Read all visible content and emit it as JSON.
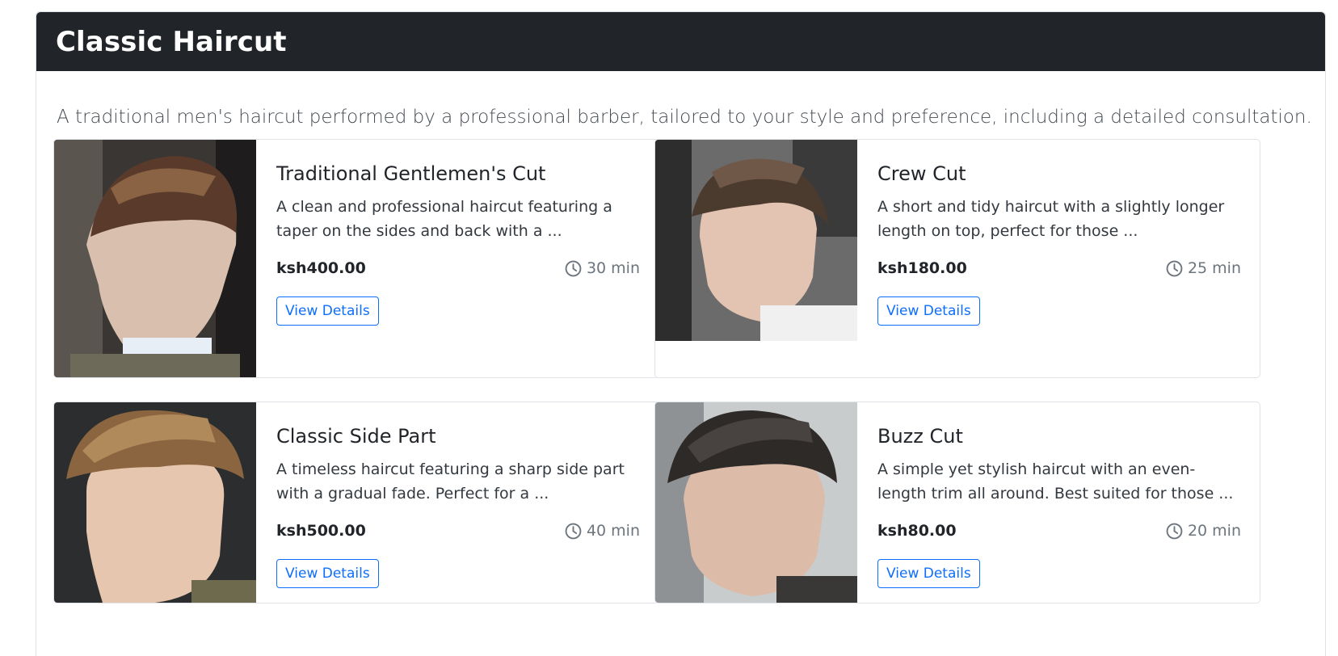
{
  "page": {
    "title": "Classic Haircut",
    "description": "A traditional men's haircut performed by a professional barber, tailored to your style and preference, including a detailed consultation."
  },
  "services": [
    {
      "name": "Traditional Gentlemen's Cut",
      "description": "A clean and professional haircut featuring a taper on the sides and back with a ...",
      "price": "ksh400.00",
      "duration": "30 min",
      "button": "View Details"
    },
    {
      "name": "Crew Cut",
      "description": "A short and tidy haircut with a slightly longer length on top, perfect for those ...",
      "price": "ksh180.00",
      "duration": "25 min",
      "button": "View Details"
    },
    {
      "name": "Classic Side Part",
      "description": "A timeless haircut featuring a sharp side part with a gradual fade. Perfect for a ...",
      "price": "ksh500.00",
      "duration": "40 min",
      "button": "View Details"
    },
    {
      "name": "Buzz Cut",
      "description": "A simple yet stylish haircut with an even-length trim all around. Best suited for those ...",
      "price": "ksh80.00",
      "duration": "20 min",
      "button": "View Details"
    }
  ],
  "icons": {
    "duration": "clock-icon"
  },
  "colors": {
    "header_bg": "#212529",
    "accent": "#0d6efd",
    "muted": "#6c757d"
  }
}
